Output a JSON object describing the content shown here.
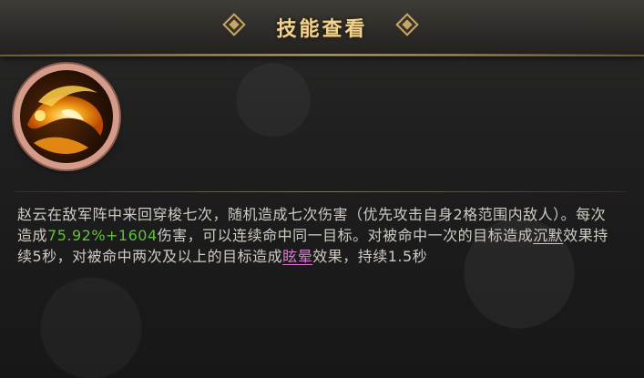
{
  "header": {
    "title": "技能查看"
  },
  "skill": {
    "icon": "flame-swirl-icon",
    "desc_1": "赵云在敌军阵中来回穿梭七次，随机造成七次伤害（优先攻击自身2格范围内敌人）。每次造成",
    "damage_value": "75.92%+1604",
    "desc_2": "伤害，可以连续命中同一目标。对被命中一次的目标造成",
    "effect_1": "沉默",
    "desc_3": "效果持续5秒，对被命中两次及以上的目标造成",
    "effect_2": "眩晕",
    "desc_4": "效果，持续1.5秒"
  },
  "colors": {
    "title": "#f0d38e",
    "text": "#cfcbc3",
    "value_green": "#5fc33a",
    "effect_purple": "#d77ad0"
  }
}
